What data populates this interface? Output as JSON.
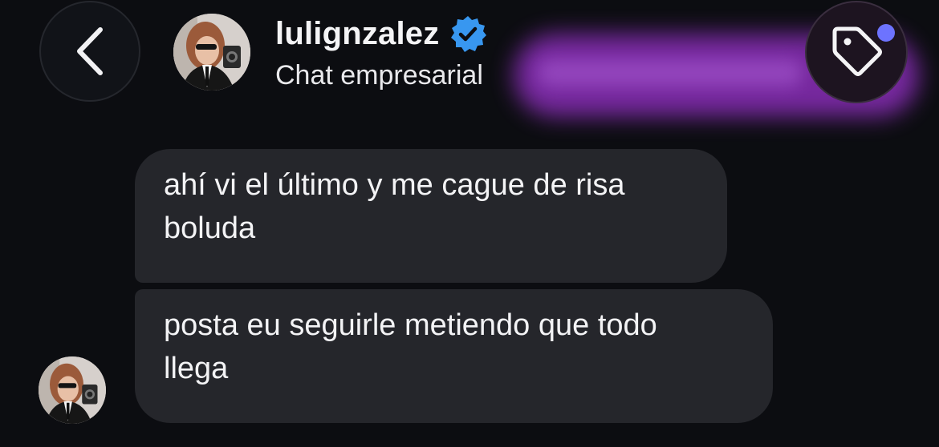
{
  "header": {
    "username": "lulignzalez",
    "subtitle": "Chat empresarial",
    "verified": true,
    "back_icon": "chevron-left-icon",
    "label_icon": "tag-icon",
    "accent_color": "#3897f0",
    "notification_color": "#6d73ff"
  },
  "messages": [
    {
      "line1": "ahí vi el último y me cague de risa",
      "line2": "boluda"
    },
    {
      "line1": "posta eu seguirle metiendo que todo",
      "line2": "llega"
    }
  ]
}
